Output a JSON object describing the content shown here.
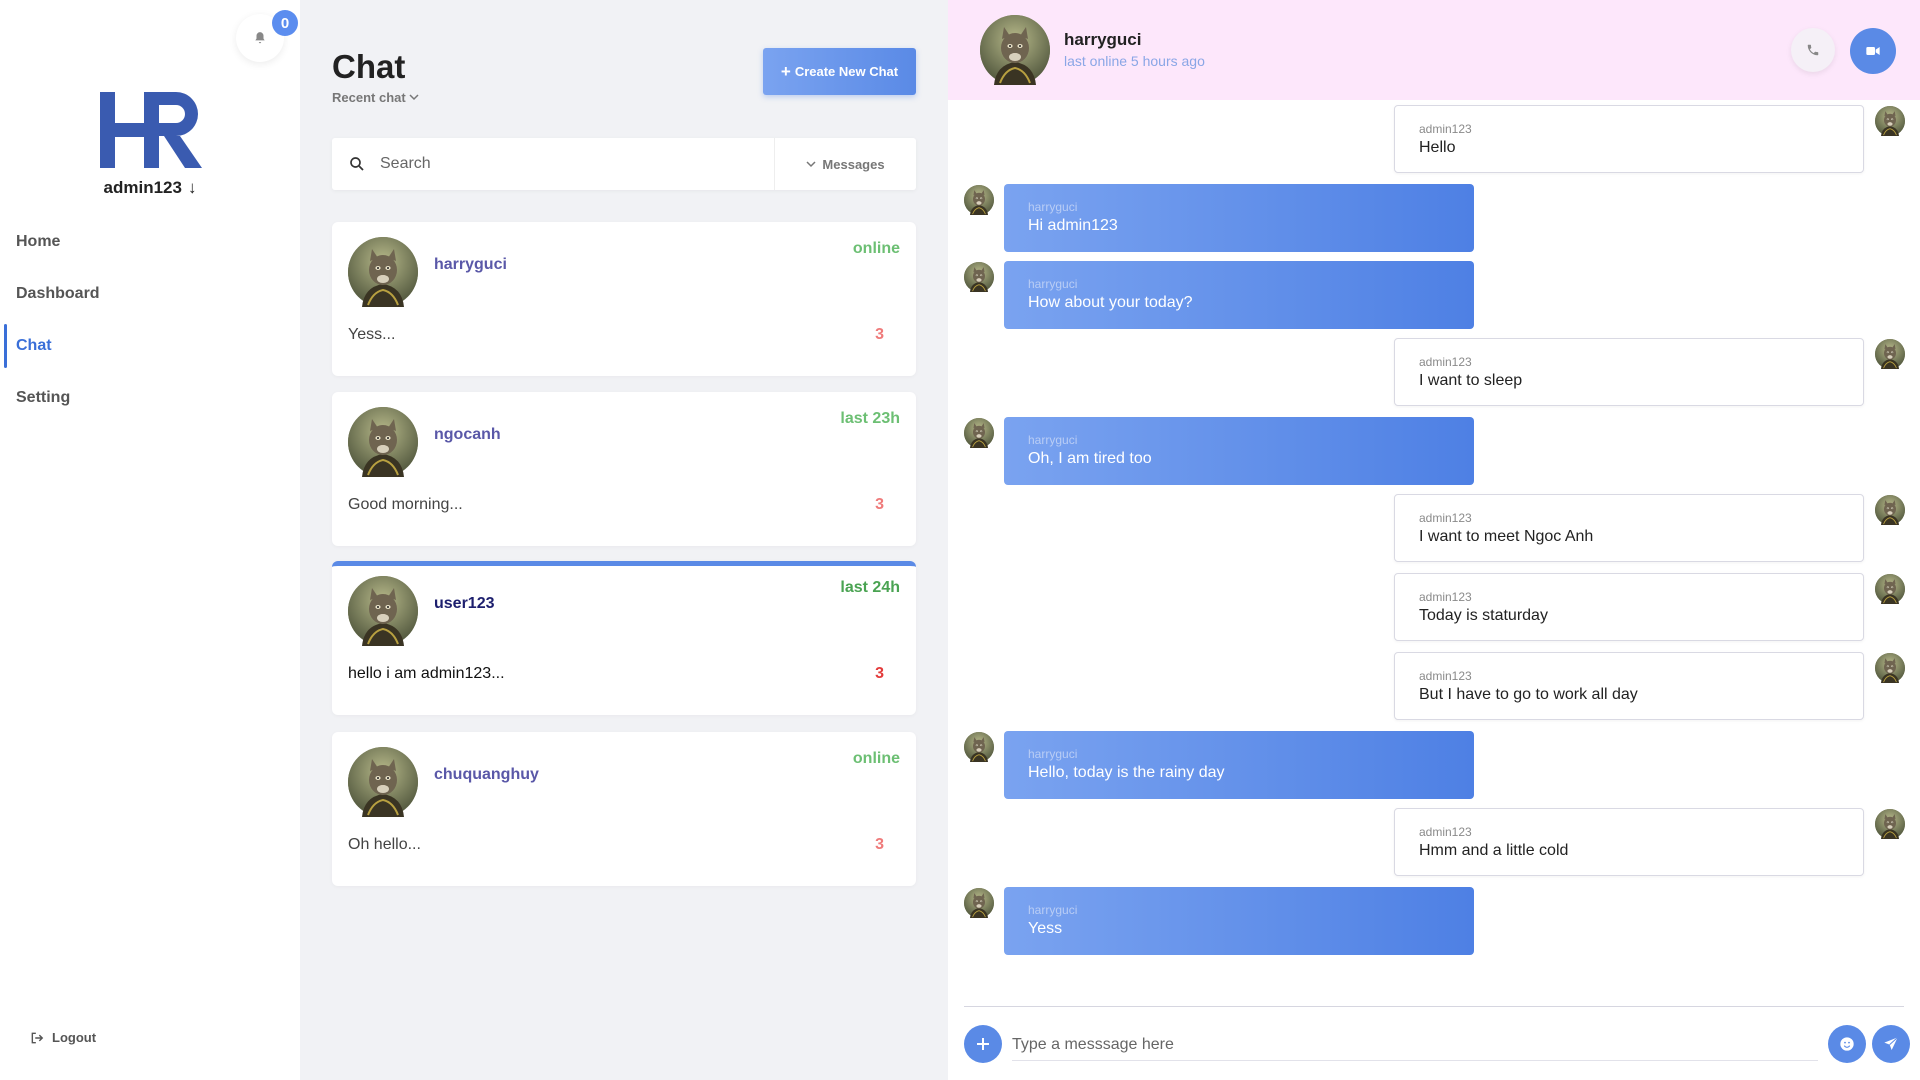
{
  "sidebar": {
    "notification_count": "0",
    "logo_text": "HR",
    "username": "admin123",
    "username_arrow": "↓",
    "nav": [
      {
        "label": "Home"
      },
      {
        "label": "Dashboard"
      },
      {
        "label": "Chat",
        "active": true
      },
      {
        "label": "Setting"
      }
    ],
    "logout_label": "Logout"
  },
  "chat_list": {
    "title": "Chat",
    "recent_label": "Recent chat",
    "create_button": "Create New Chat",
    "search_placeholder": "Search",
    "filter_label": "Messages",
    "conversations": [
      {
        "name": "harryguci",
        "status": "online",
        "preview": "Yess...",
        "unread": "3"
      },
      {
        "name": "ngocanh",
        "status": "last 23h",
        "preview": "Good morning...",
        "unread": "3"
      },
      {
        "name": "user123",
        "status": "last 24h",
        "preview": "hello i am admin123...",
        "unread": "3",
        "active": true
      },
      {
        "name": "chuquanghuy",
        "status": "online",
        "preview": "Oh hello...",
        "unread": "3"
      }
    ]
  },
  "conversation": {
    "contact_name": "harryguci",
    "contact_status": "last online 5 hours ago",
    "messages": [
      {
        "direction": "out",
        "sender": "admin123",
        "text": "Hello"
      },
      {
        "direction": "in",
        "sender": "harryguci",
        "text": "Hi admin123"
      },
      {
        "direction": "in",
        "sender": "harryguci",
        "text": "How about your today?"
      },
      {
        "direction": "out",
        "sender": "admin123",
        "text": "I want to sleep"
      },
      {
        "direction": "in",
        "sender": "harryguci",
        "text": "Oh, I am tired too"
      },
      {
        "direction": "out",
        "sender": "admin123",
        "text": "I want to meet Ngoc Anh"
      },
      {
        "direction": "out",
        "sender": "admin123",
        "text": "Today is staturday"
      },
      {
        "direction": "out",
        "sender": "admin123",
        "text": "But I have to go to work all day"
      },
      {
        "direction": "in",
        "sender": "harryguci",
        "text": "Hello, today is the rainy day"
      },
      {
        "direction": "out",
        "sender": "admin123",
        "text": "Hmm and a little cold"
      },
      {
        "direction": "in",
        "sender": "harryguci",
        "text": "Yess"
      }
    ],
    "input_placeholder": "Type a messsage here"
  },
  "colors": {
    "accent": "#5a8ae6",
    "header_bg": "#fde7fb",
    "online": "#6cbf73",
    "unread": "#ef7a7a",
    "logo": "#3a5bb0"
  },
  "icons": {
    "bell": "bell-icon",
    "search": "search-icon",
    "chevron": "chevron-down-icon",
    "plus": "plus-icon",
    "phone": "phone-icon",
    "video": "video-icon",
    "emoji": "smiley-icon",
    "send": "send-icon",
    "logout": "logout-icon"
  }
}
